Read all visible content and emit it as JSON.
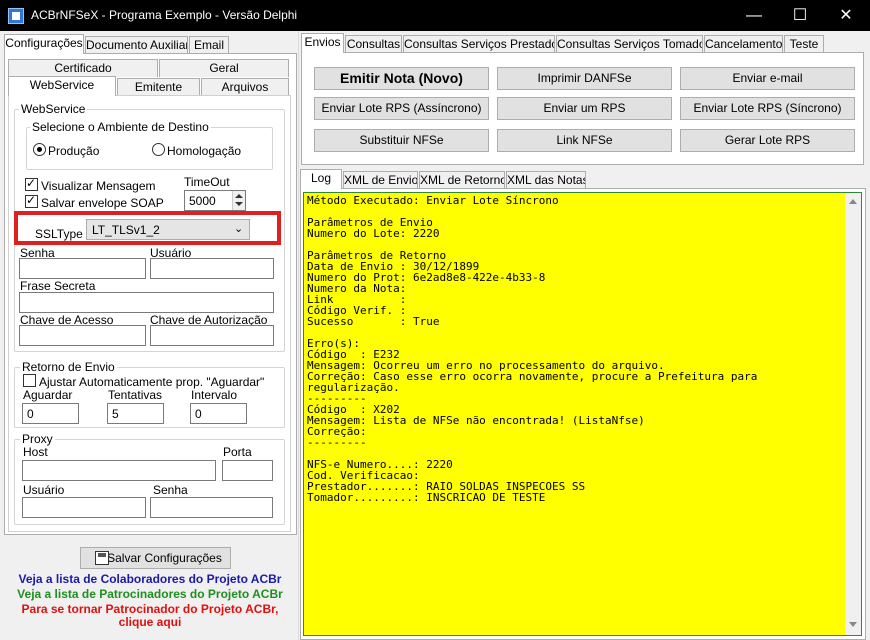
{
  "window": {
    "title": "ACBrNFSeX - Programa Exemplo - Versão Delphi"
  },
  "left": {
    "top_tabs": [
      "Configurações",
      "Documento Auxiliar",
      "Email"
    ],
    "sub_tabs_row1": [
      "Certificado",
      "Geral"
    ],
    "sub_tabs_row2": [
      "WebService",
      "Emitente",
      "Arquivos"
    ],
    "webservice_group": "WebService",
    "ambiente_group": "Selecione o Ambiente de Destino",
    "radio_producao": "Produção",
    "radio_homologacao": "Homologação",
    "chk_visualizar": "Visualizar Mensagem",
    "chk_salvar": "Salvar envelope SOAP",
    "timeout_label": "TimeOut",
    "timeout_value": "5000",
    "ssltype_label": "SSLType",
    "ssltype_value": "LT_TLSv1_2",
    "senha_label": "Senha",
    "usuario_label": "Usuário",
    "frase_label": "Frase Secreta",
    "chave_acesso_label": "Chave de Acesso",
    "chave_autorizacao_label": "Chave de Autorização",
    "retorno_group": "Retorno de Envio",
    "chk_ajustar": "Ajustar Automaticamente prop. \"Aguardar\"",
    "aguardar_label": "Aguardar",
    "aguardar_value": "0",
    "tentativas_label": "Tentativas",
    "tentativas_value": "5",
    "intervalo_label": "Intervalo",
    "intervalo_value": "0",
    "proxy_group": "Proxy",
    "host_label": "Host",
    "porta_label": "Porta",
    "proxy_usuario_label": "Usuário",
    "proxy_senha_label": "Senha",
    "salvar_button": "Salvar Configurações",
    "link_colaboradores": "Veja a lista de Colaboradores do Projeto ACBr",
    "link_patrocinadores": "Veja a lista de Patrocinadores do Projeto ACBr",
    "link_patrocinador_1": "Para se tornar Patrocinador do Projeto ACBr,",
    "link_patrocinador_2": "clique aqui"
  },
  "right": {
    "tabs": [
      "Envios",
      "Consultas",
      "Consultas Serviços Prestados",
      "Consultas Serviços Tomados",
      "Cancelamento",
      "Teste"
    ],
    "buttons": {
      "emitir": "Emitir Nota (Novo)",
      "imprimir": "Imprimir DANFSe",
      "email": "Enviar e-mail",
      "lote_assinc": "Enviar Lote RPS (Assíncrono)",
      "um_rps": "Enviar um RPS",
      "lote_sinc": "Enviar Lote RPS (Síncrono)",
      "substituir": "Substituir NFSe",
      "link": "Link NFSe",
      "gerar": "Gerar Lote RPS"
    },
    "log_tabs": [
      "Log",
      "XML de Envio",
      "XML de Retorno",
      "XML das Notas"
    ],
    "log_lines": [
      "Método Executado: Enviar Lote Síncrono",
      "",
      "Parâmetros de Envio",
      "Numero do Lote: 2220",
      "",
      "Parâmetros de Retorno",
      "Data de Envio : 30/12/1899",
      "Numero do Prot: 6e2ad8e8-422e-4b33-8",
      "Numero da Nota:",
      "Link          :",
      "Código Verif. :",
      "Sucesso       : True",
      "",
      "Erro(s):",
      "Código  : E232",
      "Mensagem: Ocorreu um erro no processamento do arquivo.",
      "Correção: Caso esse erro ocorra novamente, procure a Prefeitura para",
      "regularização.",
      "---------",
      "Código  : X202",
      "Mensagem: Lista de NFSe não encontrada! (ListaNfse)",
      "Correção:",
      "---------",
      "",
      "NFS-e Numero....: 2220",
      "Cod. Verificacao:",
      "Prestador.......: RAIO SOLDAS INSPECOES SS",
      "Tomador.........: INSCRICAO DE TESTE"
    ]
  },
  "colors": {
    "log_bg": "#ffff00",
    "highlight": "#e02020",
    "link_blue": "#1a1aa6",
    "link_green": "#1f8f1f",
    "link_red": "#e01010"
  }
}
